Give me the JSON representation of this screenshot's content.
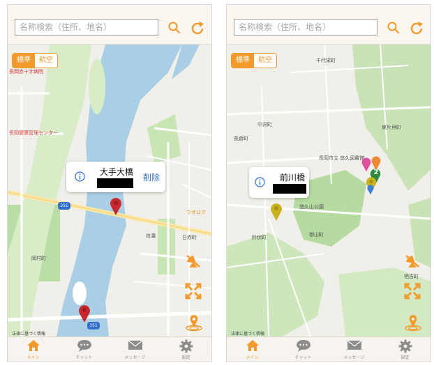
{
  "screens": [
    {
      "search": {
        "placeholder": "名称検索（住所、地名）"
      },
      "map_type": {
        "standard": "標準",
        "aerial": "航空"
      },
      "labels": {
        "hospital_red": "長岡赤十字病院",
        "health_center": "長岡健康管理センター",
        "uoroku": "ウオロク",
        "shinano": "信濃",
        "hinodecho": "日赤町",
        "okamura": "岡村町",
        "route351_a": "351",
        "route351_b": "351"
      },
      "callout": {
        "title": "大手大橋",
        "delete_label": "削除"
      },
      "legal": "法律に基づく情報"
    },
    {
      "search": {
        "placeholder": "名称検索（住所、地名）"
      },
      "map_type": {
        "standard": "標準",
        "aerial": "航空"
      },
      "labels": {
        "sendai": "千代栄町",
        "nakazawa": "中沢町",
        "nagakura": "長倉町",
        "higashikatakai": "東片貝町",
        "library": "長岡市立 悠久図書館",
        "yukyuzan": "悠久山公園",
        "suzufuse": "鈴伏町",
        "goyama": "御山町",
        "shimokichi": "栖吉町"
      },
      "cluster_count": "2",
      "callout": {
        "title": "前川橋"
      },
      "legal": "法律に基づく情報"
    }
  ],
  "tabs": [
    {
      "label": "メイン",
      "icon": "home-icon"
    },
    {
      "label": "チャット",
      "icon": "chat-icon"
    },
    {
      "label": "メッセージ",
      "icon": "mail-icon"
    },
    {
      "label": "設定",
      "icon": "gear-icon"
    }
  ],
  "colors": {
    "accent": "#f39a2c",
    "river": "#a9cfe6",
    "park": "#b5dba0",
    "pin_red": "#c8272d"
  }
}
